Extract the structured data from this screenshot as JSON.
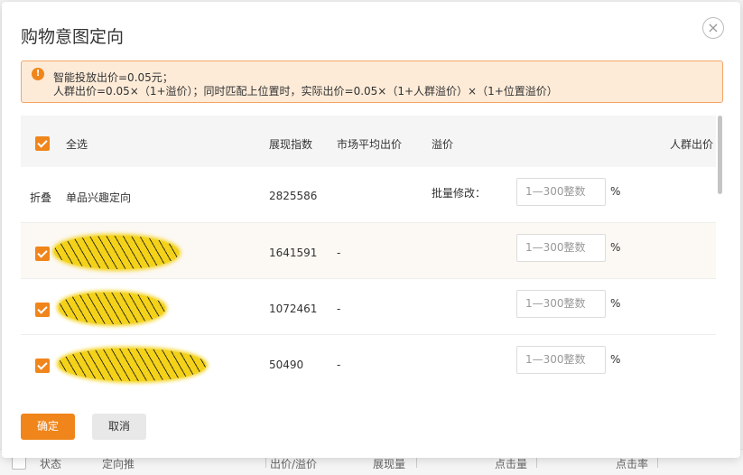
{
  "dialog": {
    "title": "购物意图定向",
    "close_icon": "×"
  },
  "notice": {
    "icon": "!",
    "line1": "智能投放出价=0.05元；",
    "line2": "人群出价=0.05×（1+溢价）；同时匹配上位置时，实际出价=0.05×（1+人群溢价）×（1+位置溢价）"
  },
  "table": {
    "headers": {
      "select_all": "全选",
      "impressions": "展现指数",
      "market_avg_bid": "市场平均出价",
      "premium": "溢价",
      "crowd_bid": "人群出价"
    },
    "group_row": {
      "toggle": "折叠",
      "name": "单品兴趣定向",
      "impressions": "2825586",
      "batch_label": "批量修改：",
      "input_placeholder": "1—300整数",
      "unit": "%"
    },
    "rows": [
      {
        "impressions": "1641591",
        "market_avg_bid": "-",
        "input_placeholder": "1—300整数",
        "unit": "%"
      },
      {
        "impressions": "1072461",
        "market_avg_bid": "-",
        "input_placeholder": "1—300整数",
        "unit": "%"
      },
      {
        "impressions": "50490",
        "market_avg_bid": "-",
        "input_placeholder": "1—300整数",
        "unit": "%"
      }
    ]
  },
  "footer": {
    "confirm": "确定",
    "cancel": "取消"
  },
  "background_table": {
    "columns": [
      "状态",
      "定向推",
      "出价/溢价",
      "展现量",
      "点击量",
      "点击率"
    ]
  },
  "colors": {
    "accent": "#f0851b",
    "notice_bg": "#fdebd8",
    "notice_border": "#f4a566"
  }
}
